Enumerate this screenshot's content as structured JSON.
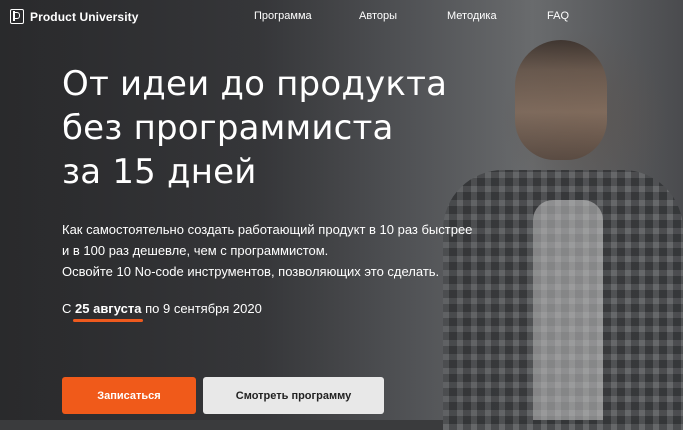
{
  "brand": {
    "name": "Product University",
    "logo_icon": "pu-logo-icon"
  },
  "nav": {
    "items": [
      {
        "label": "Программа"
      },
      {
        "label": "Авторы"
      },
      {
        "label": "Методика"
      },
      {
        "label": "FAQ"
      }
    ]
  },
  "hero": {
    "title_lines": [
      "От идеи до продукта",
      "без программиста",
      "за 15 дней"
    ],
    "description_lines": [
      "Как самостоятельно создать работающий продукт в 10 раз быстрее",
      "и в 100 раз дешевле, чем с программистом.",
      "Освойте 10 No-code инструментов, позволяющих это сделать."
    ],
    "dates": {
      "prefix": "С",
      "start": "25 августа",
      "suffix": "по 9 сентября 2020"
    },
    "buttons": {
      "primary": "Записаться",
      "secondary": "Смотреть программу"
    }
  },
  "colors": {
    "accent": "#f05a1a",
    "secondary_button": "#e8e8e8",
    "text": "#ffffff"
  }
}
